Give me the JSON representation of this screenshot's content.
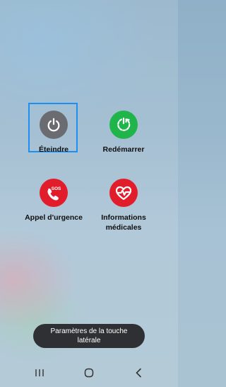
{
  "power_menu": {
    "options": [
      {
        "label": "Éteindre",
        "icon": "power-icon",
        "color": "#6a6c71"
      },
      {
        "label": "Redémarrer",
        "icon": "restart-icon",
        "color": "#1fb54a"
      },
      {
        "label": "Appel d'urgence",
        "icon": "sos-phone-icon",
        "badge": "SOS",
        "color": "#e21d2b"
      },
      {
        "label": "Informations médicales",
        "icon": "medical-heart-icon",
        "color": "#e21d2b"
      }
    ],
    "selected": "Éteindre"
  },
  "toast": {
    "text": "Paramètres de la touche latérale"
  },
  "navbar": {
    "icons": [
      "recents-icon",
      "home-icon",
      "back-icon"
    ]
  }
}
